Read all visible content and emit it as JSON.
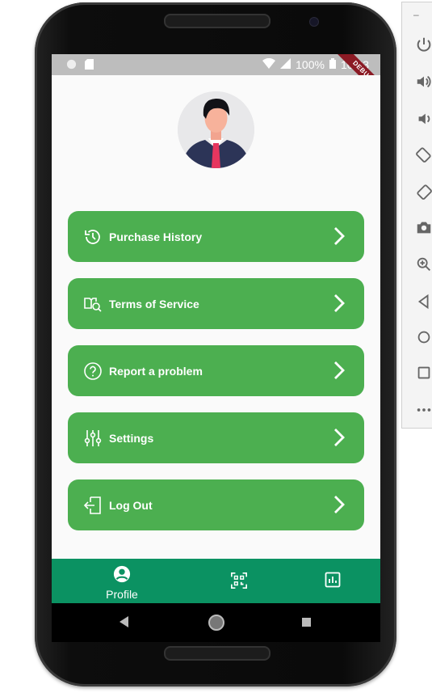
{
  "status_bar": {
    "battery": "100%",
    "time": "10:33",
    "ribbon": "DEBUG"
  },
  "profile": {
    "avatar": "user-avatar"
  },
  "menu": [
    {
      "label": "Purchase History",
      "icon": "history-icon"
    },
    {
      "label": "Terms of Service",
      "icon": "terms-search-icon"
    },
    {
      "label": "Report a problem",
      "icon": "help-circle-icon"
    },
    {
      "label": "Settings",
      "icon": "sliders-icon"
    },
    {
      "label": "Log Out",
      "icon": "logout-icon"
    }
  ],
  "bottom_nav": [
    {
      "label": "Profile",
      "icon": "account-circle-icon"
    },
    {
      "label": "",
      "icon": "qr-code-icon"
    },
    {
      "label": "",
      "icon": "chart-icon"
    }
  ],
  "colors": {
    "accent": "#4caf50",
    "nav": "#0b9262",
    "statusbar": "#bdbdbd"
  }
}
